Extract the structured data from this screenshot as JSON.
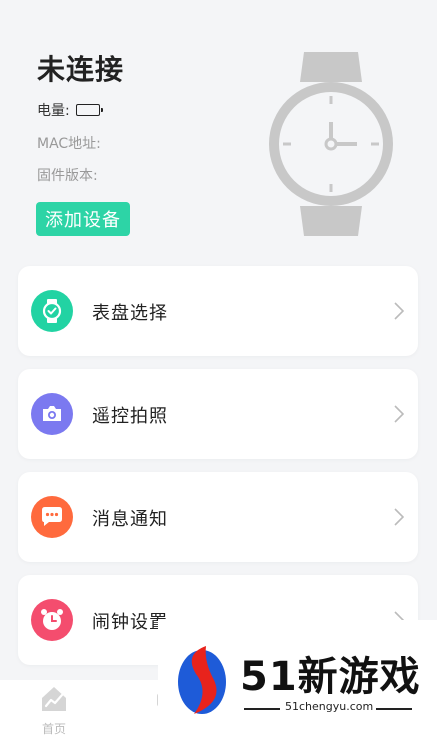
{
  "device": {
    "status": "未连接",
    "battery_label": "电量:",
    "mac_label": "MAC地址:",
    "firmware_label": "固件版本:",
    "add_button": "添加设备"
  },
  "menu": [
    {
      "label": "表盘选择",
      "icon": "watch-face-icon",
      "color": "#22d3a3"
    },
    {
      "label": "遥控拍照",
      "icon": "camera-icon",
      "color": "#7b79f0"
    },
    {
      "label": "消息通知",
      "icon": "message-icon",
      "color": "#ff6a3d"
    },
    {
      "label": "闹钟设置",
      "icon": "alarm-clock-icon",
      "color": "#f44d6e"
    }
  ],
  "bottom_nav": {
    "home_label": "首页"
  },
  "watermark": {
    "brand": "51新游戏",
    "url": "51chengyu.com"
  },
  "colors": {
    "accent": "#2dd4a6",
    "background": "#f4f5f7",
    "watch_gray": "#c8c8c8"
  }
}
